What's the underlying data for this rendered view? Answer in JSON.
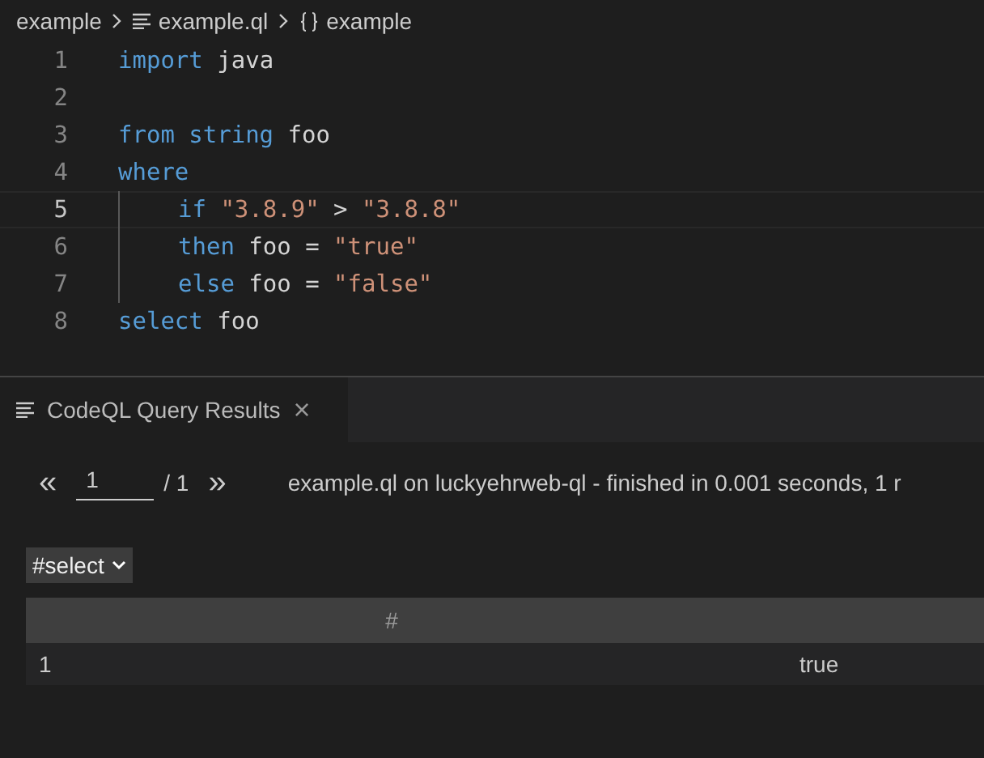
{
  "breadcrumb": [
    {
      "label": "example",
      "kind": "folder"
    },
    {
      "label": "example.ql",
      "kind": "file"
    },
    {
      "label": "example",
      "kind": "symbol"
    }
  ],
  "editor": {
    "lines": [
      {
        "number": "1",
        "current": false,
        "indent": false,
        "tokens": [
          {
            "kind": "keyword",
            "text": "import"
          },
          {
            "kind": "plain",
            "text": "java"
          }
        ]
      },
      {
        "number": "2",
        "current": false,
        "indent": false
      },
      {
        "number": "3",
        "current": false,
        "indent": false,
        "tokens": [
          {
            "kind": "keyword",
            "text": "from"
          },
          {
            "kind": "keyword",
            "text": "string"
          },
          {
            "kind": "plain",
            "text": "foo"
          }
        ]
      },
      {
        "number": "4",
        "current": false,
        "indent": false,
        "tokens": [
          {
            "kind": "keyword",
            "text": "where"
          }
        ]
      },
      {
        "number": "5",
        "current": true,
        "indent": true,
        "tokens": [
          {
            "kind": "keyword",
            "text": "if"
          },
          {
            "kind": "string",
            "text": "\"3.8.9\""
          },
          {
            "kind": "plain",
            "text": ">"
          },
          {
            "kind": "string",
            "text": "\"3.8.8\""
          }
        ]
      },
      {
        "number": "6",
        "current": false,
        "indent": true,
        "tokens": [
          {
            "kind": "keyword",
            "text": "then"
          },
          {
            "kind": "plain",
            "text": "foo ="
          },
          {
            "kind": "string",
            "text": "\"true\""
          }
        ]
      },
      {
        "number": "7",
        "current": false,
        "indent": true,
        "tokens": [
          {
            "kind": "keyword",
            "text": "else"
          },
          {
            "kind": "plain",
            "text": "foo ="
          },
          {
            "kind": "string",
            "text": "\"false\""
          }
        ]
      },
      {
        "number": "8",
        "current": false,
        "indent": false,
        "tokens": [
          {
            "kind": "keyword",
            "text": "select"
          },
          {
            "kind": "plain",
            "text": "foo"
          }
        ]
      }
    ]
  },
  "panel": {
    "tab": {
      "label": "CodeQL Query Results",
      "close": "×"
    },
    "pager": {
      "first": "«",
      "page": "1",
      "total": "/ 1",
      "last": "»"
    },
    "status": "example.ql on luckyehrweb-ql - finished in 0.001 seconds, 1 r",
    "result_set": "#select",
    "table": {
      "columns": [
        "#"
      ],
      "rows": [
        [
          "1",
          "true"
        ]
      ]
    }
  }
}
